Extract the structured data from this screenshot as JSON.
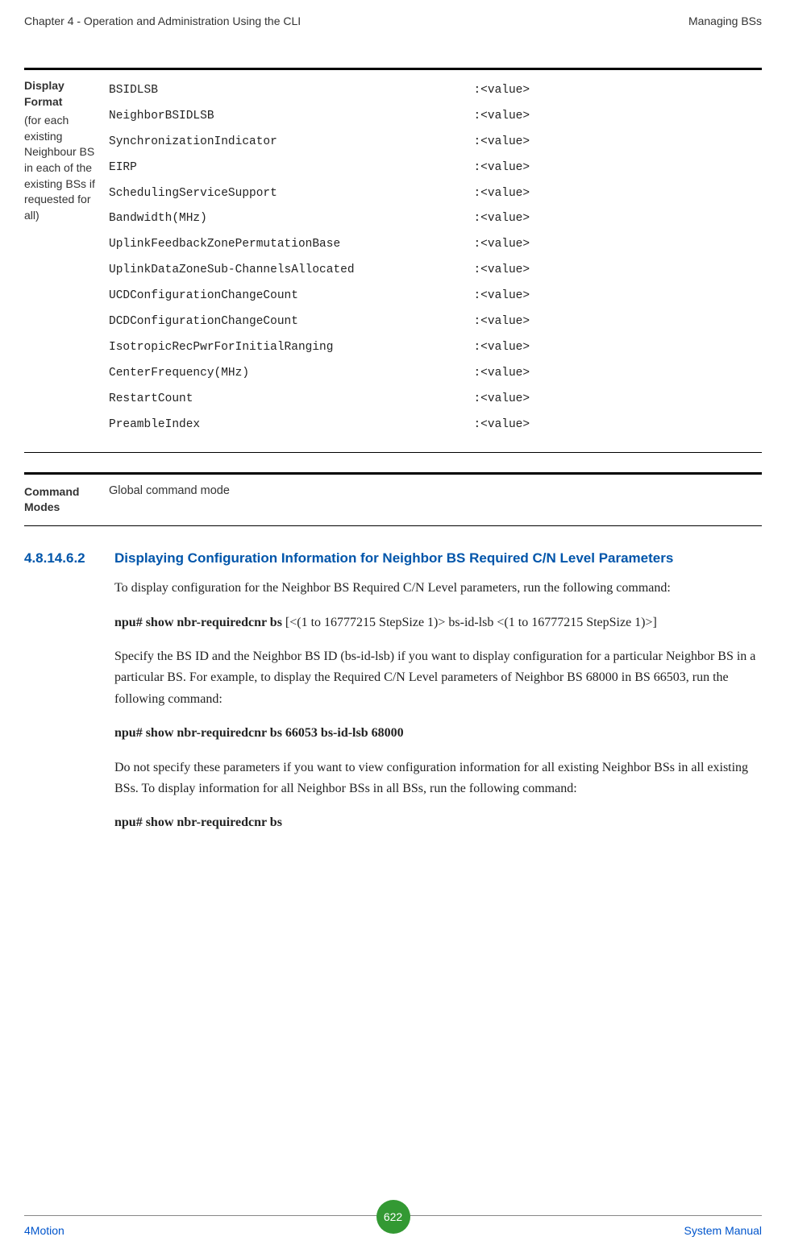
{
  "header": {
    "left": "Chapter 4 - Operation and Administration Using the CLI",
    "right": "Managing BSs"
  },
  "displayFormat": {
    "labelTitle": "Display Format",
    "labelSub": "(for each existing Neighbour BS in each of the existing BSs if requested for all)",
    "rows": [
      {
        "key": "BSIDLSB",
        "val": ":<value>"
      },
      {
        "key": "NeighborBSIDLSB",
        "val": ":<value>"
      },
      {
        "key": "SynchronizationIndicator",
        "val": ":<value>"
      },
      {
        "key": "EIRP",
        "val": ":<value>"
      },
      {
        "key": "SchedulingServiceSupport",
        "val": ":<value>"
      },
      {
        "key": "Bandwidth(MHz)",
        "val": ":<value>"
      },
      {
        "key": "UplinkFeedbackZonePermutationBase",
        "val": ":<value>"
      },
      {
        "key": "UplinkDataZoneSub-ChannelsAllocated",
        "val": ":<value>"
      },
      {
        "key": "UCDConfigurationChangeCount",
        "val": ":<value>"
      },
      {
        "key": "DCDConfigurationChangeCount",
        "val": ":<value>"
      },
      {
        "key": "IsotropicRecPwrForInitialRanging",
        "val": ":<value>"
      },
      {
        "key": "CenterFrequency(MHz)",
        "val": ":<value>"
      },
      {
        "key": "RestartCount",
        "val": ":<value>"
      },
      {
        "key": "PreambleIndex",
        "val": ":<value>"
      }
    ]
  },
  "commandModes": {
    "label": "Command Modes",
    "value": "Global command mode"
  },
  "section": {
    "number": "4.8.14.6.2",
    "title": "Displaying Configuration Information for Neighbor BS Required C/N Level Parameters",
    "p1": "To display configuration for the Neighbor BS Required C/N Level parameters, run the following command:",
    "cmd1a": "npu# show nbr-requiredcnr bs ",
    "cmd1b": "[<(1 to 16777215 StepSize 1)> bs-id-lsb <(1 to 16777215 StepSize 1)>]",
    "p2": "Specify the BS ID and the Neighbor BS ID (bs-id-lsb) if you want to display configuration for a particular Neighbor BS in a particular BS. For example, to display the Required C/N Level parameters of Neighbor BS 68000 in BS 66503, run the following command:",
    "cmd2": "npu# show nbr-requiredcnr bs 66053 bs-id-lsb 68000",
    "p3": "Do not specify these parameters if you want to view configuration information for all existing Neighbor BSs in all existing BSs. To display information for all Neighbor BSs in all BSs, run the following command:",
    "cmd3": "npu# show nbr-requiredcnr bs"
  },
  "footer": {
    "left": "4Motion",
    "center": "622",
    "right": "System Manual"
  }
}
